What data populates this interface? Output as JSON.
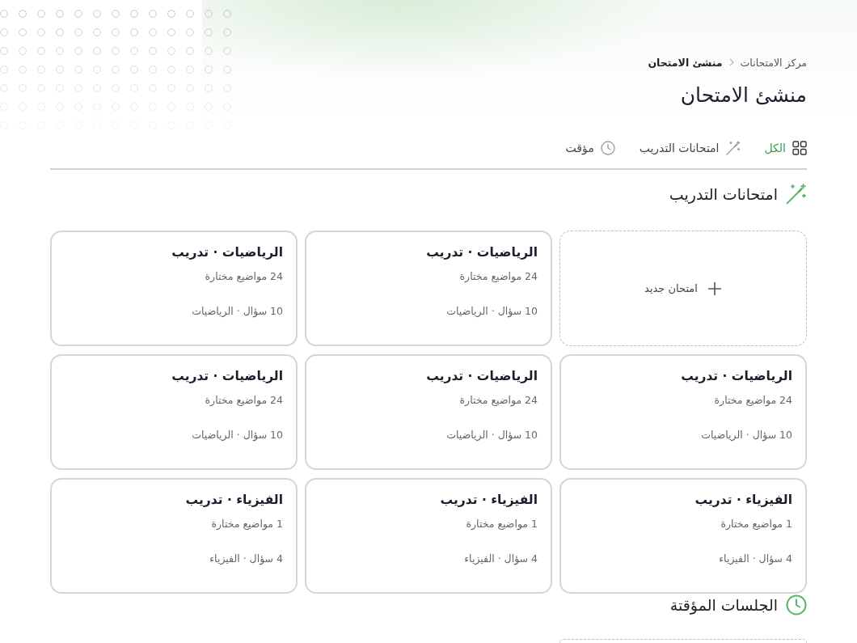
{
  "breadcrumb": [
    {
      "label": "مركز الامتحانات",
      "current": false
    },
    {
      "label": "منشئ الامتحان",
      "current": true
    }
  ],
  "page_title": "منشئ الامتحان",
  "tabs": [
    {
      "kind": "all",
      "label": "الكل",
      "selected": true
    },
    {
      "kind": "practice",
      "label": "امتحانات التدريب",
      "selected": false
    },
    {
      "kind": "timed",
      "label": "مؤقت",
      "selected": false
    }
  ],
  "sections": [
    {
      "kind": "practice",
      "title": "امتحانات التدريب",
      "cards": [
        {
          "kind": "new",
          "label": "امتحان جديد"
        },
        {
          "kind": "exam",
          "title": "الرياضيات · تدريب",
          "topics": "24 مواضيع مختارة",
          "meta": "10 سؤال · الرياضيات"
        },
        {
          "kind": "exam",
          "title": "الرياضيات · تدريب",
          "topics": "24 مواضيع مختارة",
          "meta": "10 سؤال · الرياضيات"
        },
        {
          "kind": "exam",
          "title": "الرياضيات · تدريب",
          "topics": "24 مواضيع مختارة",
          "meta": "10 سؤال · الرياضيات"
        },
        {
          "kind": "exam",
          "title": "الرياضيات · تدريب",
          "topics": "24 مواضيع مختارة",
          "meta": "10 سؤال · الرياضيات"
        },
        {
          "kind": "exam",
          "title": "الرياضيات · تدريب",
          "topics": "24 مواضيع مختارة",
          "meta": "10 سؤال · الرياضيات"
        },
        {
          "kind": "exam",
          "title": "الفيزياء · تدريب",
          "topics": "1 مواضيع مختارة",
          "meta": "4 سؤال · الفيزياء"
        },
        {
          "kind": "exam",
          "title": "الفيزياء · تدريب",
          "topics": "1 مواضيع مختارة",
          "meta": "4 سؤال · الفيزياء"
        },
        {
          "kind": "exam",
          "title": "الفيزياء · تدريب",
          "topics": "1 مواضيع مختارة",
          "meta": "4 سؤال · الفيزياء"
        }
      ]
    },
    {
      "kind": "timed",
      "title": "الجلسات المؤقتة",
      "cards": [
        {
          "kind": "new"
        }
      ]
    }
  ]
}
